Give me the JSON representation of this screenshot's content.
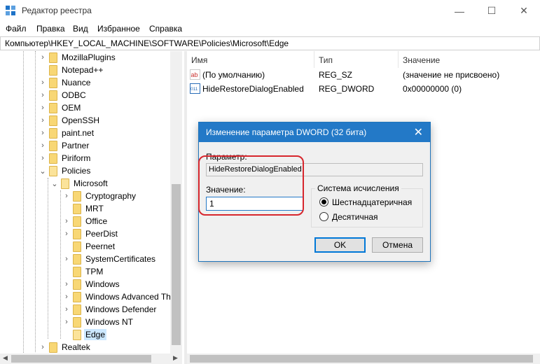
{
  "window": {
    "title": "Редактор реестра",
    "minimize": "—",
    "maximize": "☐",
    "close": "✕"
  },
  "menu": [
    "Файл",
    "Правка",
    "Вид",
    "Избранное",
    "Справка"
  ],
  "address": "Компьютер\\HKEY_LOCAL_MACHINE\\SOFTWARE\\Policies\\Microsoft\\Edge",
  "tree": [
    {
      "label": "MozillaPlugins",
      "chevron": "›"
    },
    {
      "label": "Notepad++",
      "chevron": ""
    },
    {
      "label": "Nuance",
      "chevron": "›"
    },
    {
      "label": "ODBC",
      "chevron": "›"
    },
    {
      "label": "OEM",
      "chevron": "›"
    },
    {
      "label": "OpenSSH",
      "chevron": "›"
    },
    {
      "label": "paint.net",
      "chevron": "›"
    },
    {
      "label": "Partner",
      "chevron": "›"
    },
    {
      "label": "Piriform",
      "chevron": "›"
    },
    {
      "label": "Policies",
      "chevron": "⌄"
    },
    {
      "label": "Microsoft",
      "chevron": "⌄"
    },
    {
      "label": "Cryptography",
      "chevron": "›"
    },
    {
      "label": "MRT",
      "chevron": ""
    },
    {
      "label": "Office",
      "chevron": "›"
    },
    {
      "label": "PeerDist",
      "chevron": "›"
    },
    {
      "label": "Peernet",
      "chevron": ""
    },
    {
      "label": "SystemCertificates",
      "chevron": "›"
    },
    {
      "label": "TPM",
      "chevron": ""
    },
    {
      "label": "Windows",
      "chevron": "›"
    },
    {
      "label": "Windows Advanced Th",
      "chevron": "›"
    },
    {
      "label": "Windows Defender",
      "chevron": "›"
    },
    {
      "label": "Windows NT",
      "chevron": "›"
    },
    {
      "label": "Edge",
      "chevron": ""
    },
    {
      "label": "Realtek",
      "chevron": "›"
    }
  ],
  "list": {
    "headers": [
      "Имя",
      "Тип",
      "Значение"
    ],
    "rows": [
      {
        "name": "(По умолчанию)",
        "type": "REG_SZ",
        "value": "(значение не присвоено)",
        "icon": "string-value-icon",
        "icon_text": "ab"
      },
      {
        "name": "HideRestoreDialogEnabled",
        "type": "REG_DWORD",
        "value": "0x00000000 (0)",
        "icon": "binary-value-icon",
        "icon_text": "011"
      }
    ]
  },
  "dialog": {
    "title": "Изменение параметра DWORD (32 бита)",
    "close": "✕",
    "param_label": "Параметр:",
    "param_value": "HideRestoreDialogEnabled",
    "value_label": "Значение:",
    "value": "1",
    "base_title": "Система исчисления",
    "radio_hex": "Шестнадцатеричная",
    "radio_dec": "Десятичная",
    "hex_checked": true,
    "ok": "OK",
    "cancel": "Отмена"
  },
  "colors": {
    "accent": "#2379c7",
    "highlight": "#d7262d",
    "folder": "#f8d775",
    "selection": "#cce8ff"
  }
}
